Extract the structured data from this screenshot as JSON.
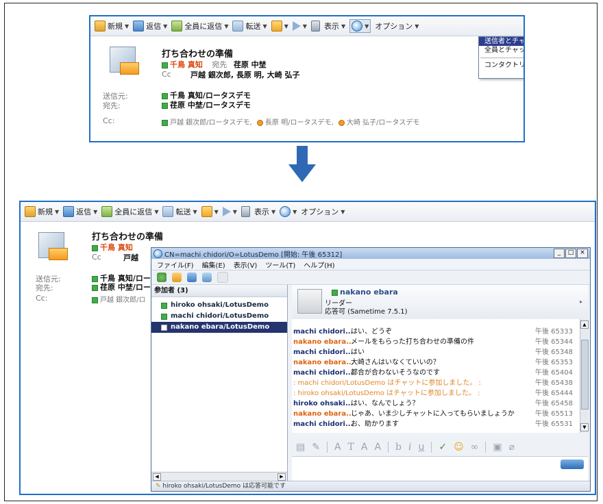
{
  "toolbar": {
    "new": "新規",
    "reply": "返信",
    "reply_all": "全員に返信",
    "forward": "転送",
    "view": "表示",
    "options": "オプション"
  },
  "dropdown": {
    "items": [
      "送信者とチャット(C)...",
      "全員とチャット(H)...",
      "コンタクトリストに送信者を追加(L)..."
    ]
  },
  "email": {
    "subject": "打ち合わせの準備",
    "sender_name": "千鳥 真知",
    "to_label": "宛先",
    "to_value": "荏原 中埜",
    "cc_label": "Cc",
    "cc_value": "戸越 銀次郎, 長原 明, 大崎 弘子",
    "from_label": "送信元:",
    "from_value": "千鳥 真知/ロータスデモ",
    "recipient_label": "宛先:",
    "recipient_value": "荏原 中埜/ロータスデモ",
    "cc_row_label": "Cc:",
    "cc_row_values": [
      "戸越 銀次郎/ロータスデモ,",
      "長原 明/ロータスデモ,",
      "大崎 弘子/ロータスデモ"
    ],
    "bottom_sender_short": "千鳥 真知",
    "bottom_cc_short": "戸越",
    "bottom_from_short": "千鳥 真知/ロー",
    "bottom_to_short": "荏原 中埜/ロー",
    "bottom_cc_row_short": "戸越 銀次郎/ロ"
  },
  "chat": {
    "title": "CN=machi chidori/O=LotusDemo [開始: 午後 65312]",
    "menus": [
      "ファイル(F)",
      "編集(E)",
      "表示(V)",
      "ツール(T)",
      "ヘルプ(H)"
    ],
    "participants_header": "参加者 (3)",
    "participants": [
      "hiroko ohsaki/LotusDemo",
      "machi chidori/LotusDemo",
      "nakano ebara/LotusDemo"
    ],
    "profile": {
      "name": "nakano ebara",
      "role": "リーダー",
      "status": "応答可 (Sametime 7.5.1)"
    },
    "messages": [
      {
        "who": "machi chidori...",
        "text": "はい、どうぞ",
        "time": "午後 65333",
        "kind": "b"
      },
      {
        "who": "nakano ebara...",
        "text": "メールをもらった打ち合わせの準備の件",
        "time": "午後 65344",
        "kind": "o"
      },
      {
        "who": "machi chidori...",
        "text": "はい",
        "time": "午後 65348",
        "kind": "b"
      },
      {
        "who": "nakano ebara...",
        "text": "大崎さんはいなくていいの？",
        "time": "午後 65353",
        "kind": "o"
      },
      {
        "who": "machi chidori...",
        "text": "都合が合わないそうなのです",
        "time": "午後 65404",
        "kind": "b"
      },
      {
        "who": "",
        "text": ": machi chidori/LotusDemo はチャットに参加しました。 :",
        "time": "午後 65438",
        "kind": "sys"
      },
      {
        "who": "",
        "text": ": hiroko ohsaki/LotusDemo はチャットに参加しました。 :",
        "time": "午後 65444",
        "kind": "sys"
      },
      {
        "who": "hiroko ohsaki...",
        "text": "はい、なんでしょう？",
        "time": "午後 65458",
        "kind": "b"
      },
      {
        "who": "nakano ebara...",
        "text": "じゃあ、いま少しチャットに入ってもらいましょうか",
        "time": "午後 65513",
        "kind": "o"
      },
      {
        "who": "machi chidori...",
        "text": "お、助かります",
        "time": "午後 65531",
        "kind": "b"
      }
    ],
    "status_bar": "hiroko ohsaki/LotusDemo は応答可能です"
  }
}
